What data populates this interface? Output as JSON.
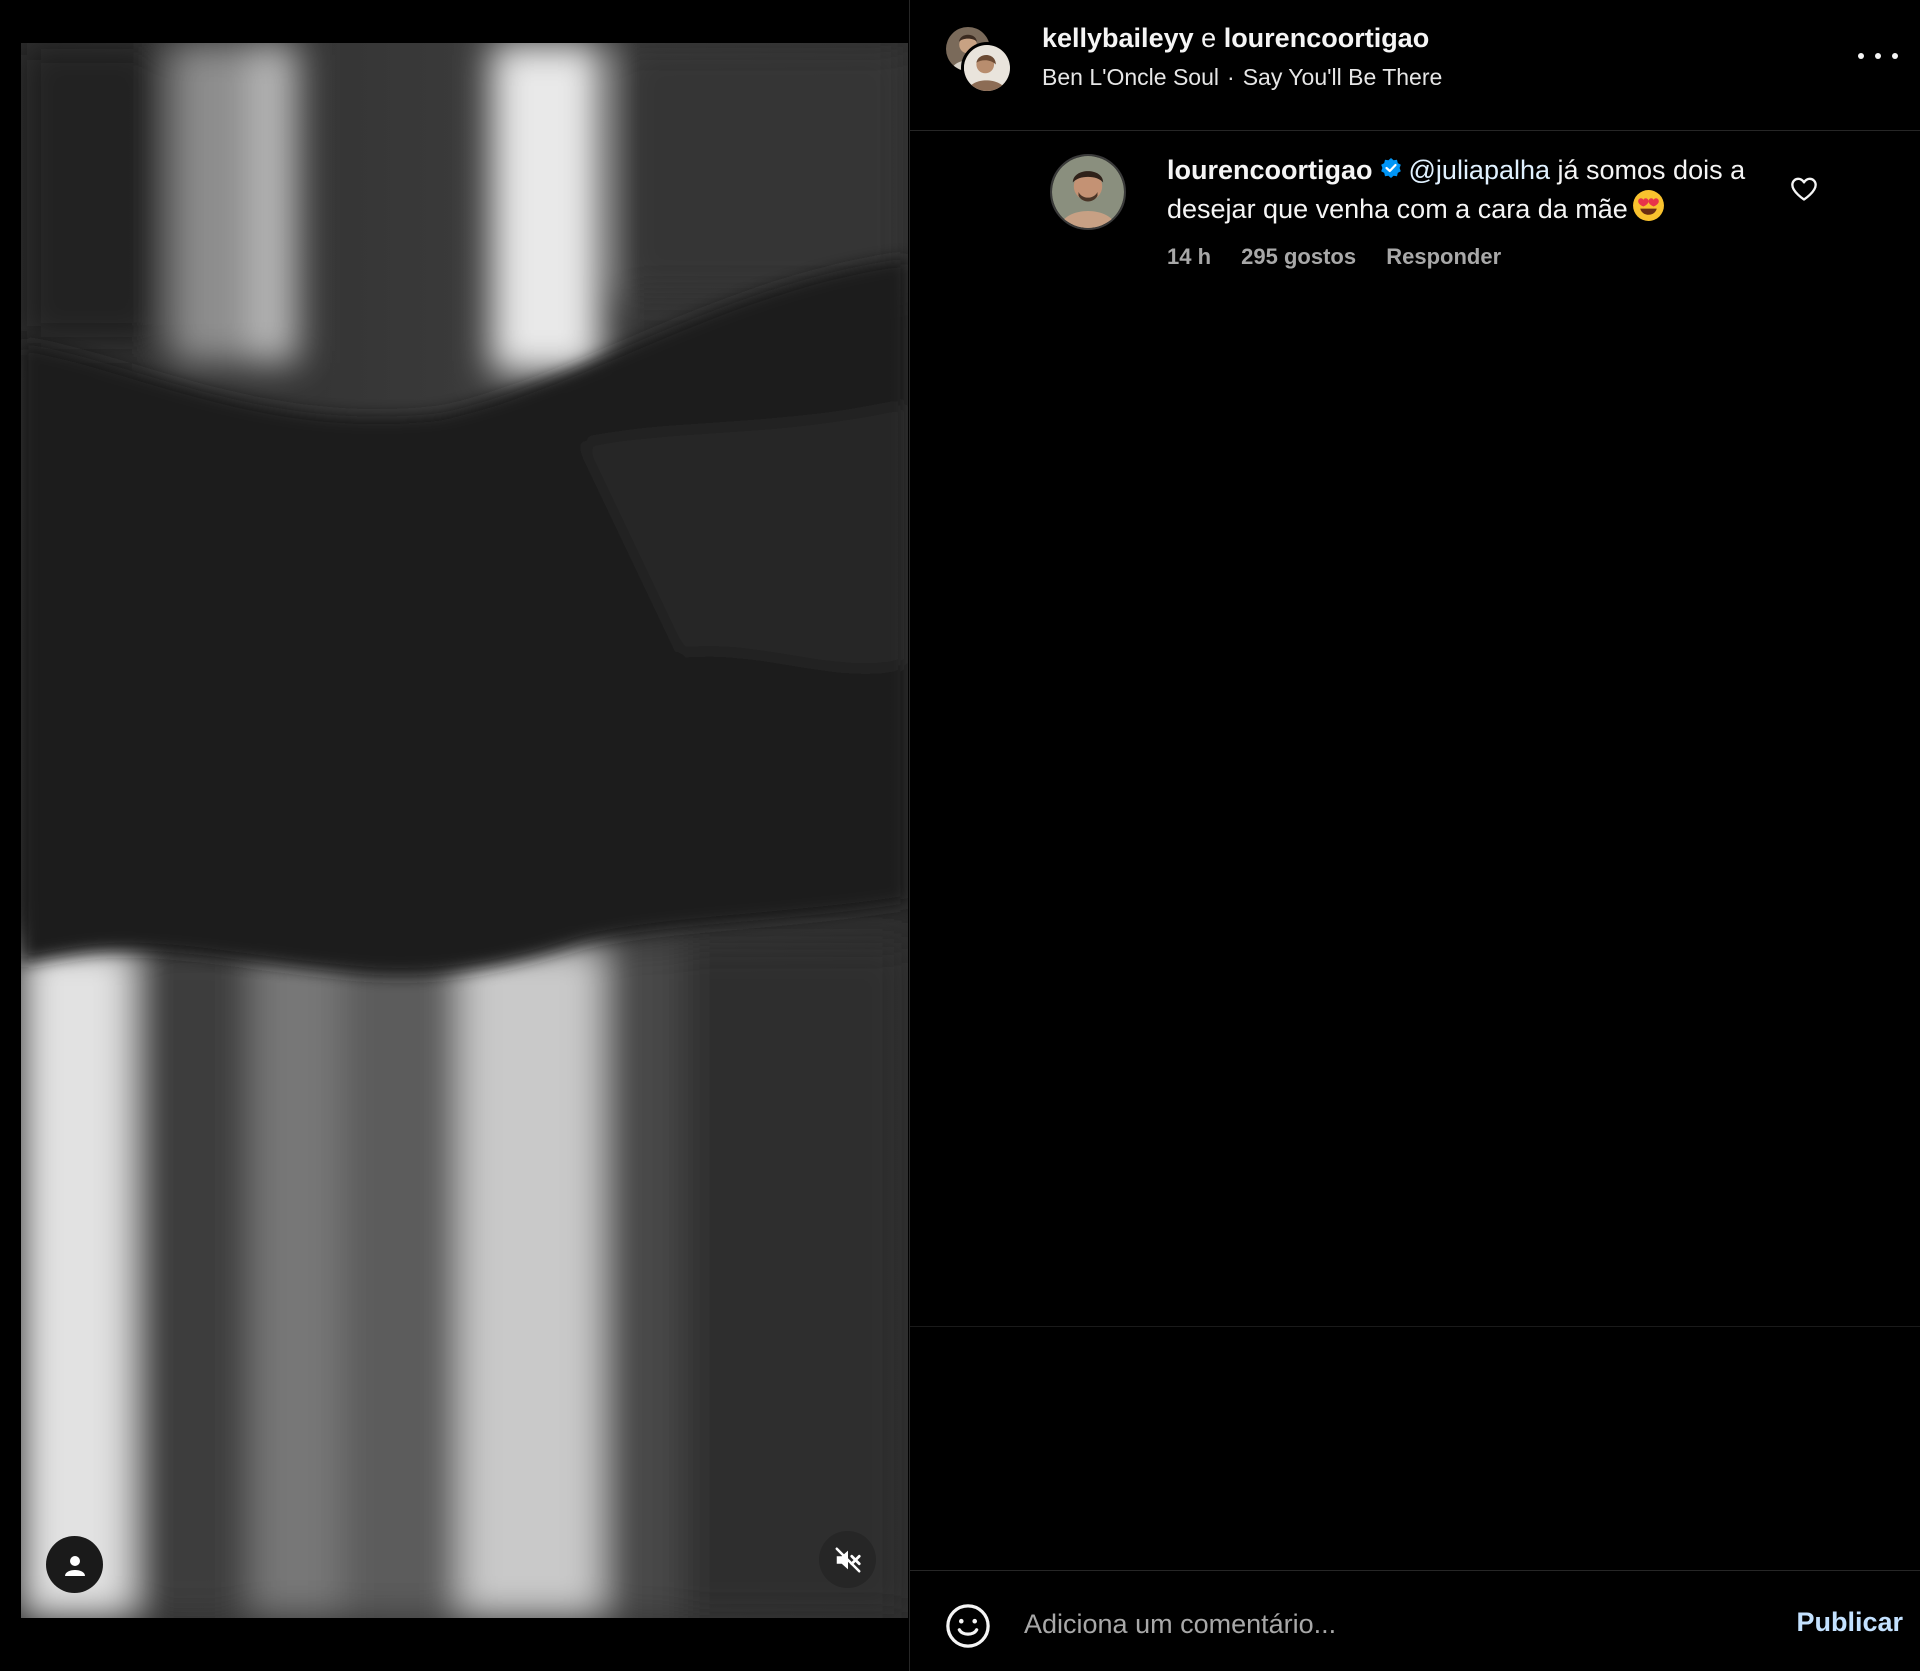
{
  "header": {
    "user_one": "kellybaileyy",
    "joiner": "e",
    "user_two": "lourencoortigao",
    "music_artist": "Ben L'Oncle Soul",
    "music_separator": "·",
    "music_track": "Say You'll Be There"
  },
  "comments": [
    {
      "username": "lourencoortigao",
      "verified": true,
      "mention": "@juliapalha",
      "text": " já somos dois a desejar que venha com a cara da mãe",
      "emoji": "smiling-face-with-heart-eyes",
      "time": "14 h",
      "likes": "295 gostos",
      "reply_label": "Responder"
    }
  ],
  "composer": {
    "placeholder": "Adiciona um comentário...",
    "publish_label": "Publicar"
  },
  "icons": {
    "tagged": "user-icon",
    "mute": "speaker-muted-icon",
    "more": "more-options-icon",
    "like": "heart-icon",
    "emoji": "smiley-icon"
  },
  "colors": {
    "background": "#000000",
    "verified": "#0095f6",
    "publish": "#c3e1ff",
    "secondary_text": "#a8a8a8"
  }
}
